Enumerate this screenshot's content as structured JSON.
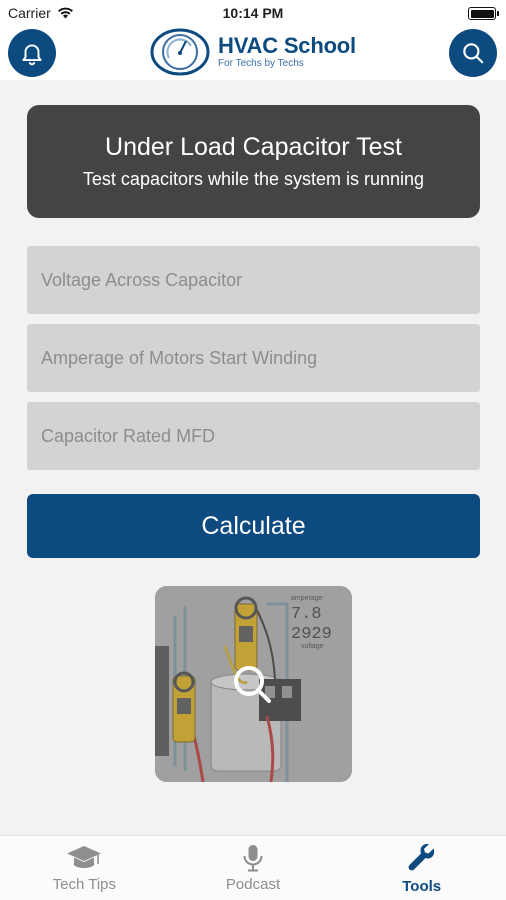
{
  "status_bar": {
    "carrier": "Carrier",
    "time": "10:14 PM"
  },
  "header": {
    "logo_title": "HVAC School",
    "logo_subtitle": "For Techs by Techs",
    "notifications_icon": "bell-icon",
    "search_icon": "search-icon"
  },
  "card": {
    "title": "Under Load Capacitor Test",
    "subtitle": "Test capacitors while the system is running"
  },
  "form": {
    "voltage_placeholder": "Voltage Across Capacitor",
    "amperage_placeholder": "Amperage of Motors Start Winding",
    "mfd_placeholder": "Capacitor Rated MFD",
    "calculate_label": "Calculate"
  },
  "thumbnail": {
    "icon": "magnifier-icon",
    "meter_reading_1": "7.8",
    "meter_reading_2": "2929",
    "meter_caption_1": "amperage",
    "meter_caption_2": "voltage"
  },
  "tabs": [
    {
      "label": "Tech Tips",
      "icon": "graduation-cap-icon",
      "active": false
    },
    {
      "label": "Podcast",
      "icon": "microphone-icon",
      "active": false
    },
    {
      "label": "Tools",
      "icon": "wrench-icon",
      "active": true
    }
  ],
  "colors": {
    "brand": "#0d4a80",
    "card_bg": "#444444",
    "field_bg": "#d3d3d3",
    "page_bg": "#f2f2f2"
  }
}
